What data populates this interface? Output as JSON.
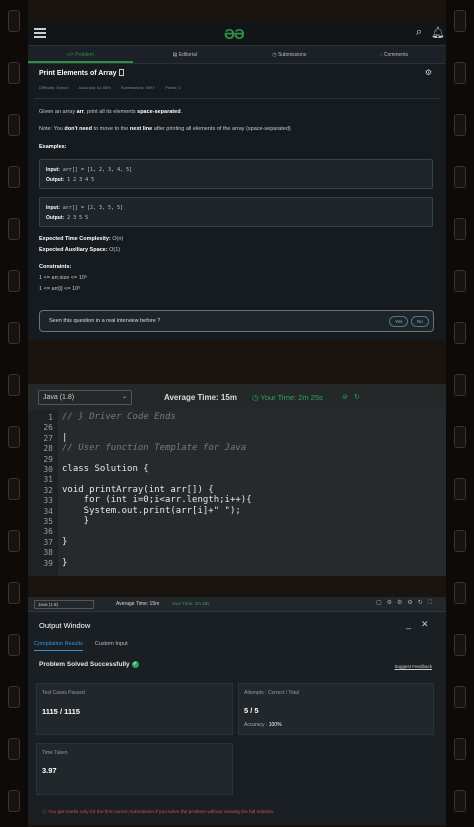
{
  "problem_panel": {
    "logo": "ƏƏ",
    "tabs": [
      "</> Problem",
      "▤ Editorial",
      "◷ Submissions",
      "◌ Comments"
    ],
    "title": "Print Elements of Array",
    "meta": [
      "Difficulty: School",
      "Accuracy: 61.55%",
      "Submissions: 90K+",
      "Points: 0"
    ],
    "description": [
      "Given an array ",
      "arr",
      ", print all its elements ",
      "space-separated",
      "."
    ],
    "note": [
      "Note: You ",
      "don't need",
      " to move to the ",
      "next line",
      " after printing all elements of the array (space-separated)"
    ],
    "examples_label": "Examples:",
    "example1": {
      "input_label": "Input:",
      "input": "arr[] = [1, 2, 3, 4, 5]",
      "output_label": "Output:",
      "output": "1 2 3 4 5"
    },
    "example2": {
      "input_label": "Input:",
      "input": "arr[] = [2, 3, 5, 5]",
      "output_label": "Output:",
      "output": "2 3 5 5"
    },
    "time_complexity_label": "Expected Time Complexity:",
    "time_complexity": "O(n)",
    "space_label": "Expected Auxiliary Space:",
    "space": "O(1)",
    "constraints_label": "Constraints:",
    "constraint1": "1 <= arr.size <= 10⁶",
    "constraint2": "1 <= arr[i] <= 10⁶",
    "interview_question": "Seen this question in a real interview before ?",
    "yes": "Yes",
    "no": "No"
  },
  "editor_panel": {
    "language": "Java (1.8)",
    "average_time": "Average Time: 15m",
    "your_time": "Your Time: 2m 25s",
    "lines": [
      {
        "n": "1",
        "text": "// } Driver Code Ends",
        "kind": "cmt"
      },
      {
        "n": "26",
        "text": "",
        "kind": ""
      },
      {
        "n": "27",
        "text": "|",
        "kind": ""
      },
      {
        "n": "28",
        "text": "// User function Template for Java",
        "kind": "cmt"
      },
      {
        "n": "29",
        "text": "",
        "kind": ""
      },
      {
        "n": "30",
        "text": "class Solution {",
        "kind": ""
      },
      {
        "n": "31",
        "text": "",
        "kind": ""
      },
      {
        "n": "32",
        "text": "void printArray(int arr[]) {",
        "kind": ""
      },
      {
        "n": "33",
        "text": "    for (int i=0;i<arr.length;i++){",
        "kind": ""
      },
      {
        "n": "34",
        "text": "    System.out.print(arr[i]+\" \");",
        "kind": ""
      },
      {
        "n": "35",
        "text": "    }",
        "kind": ""
      },
      {
        "n": "36",
        "text": "",
        "kind": ""
      },
      {
        "n": "37",
        "text": "}",
        "kind": ""
      },
      {
        "n": "38",
        "text": "",
        "kind": ""
      },
      {
        "n": "39",
        "text": "}",
        "kind": ""
      }
    ]
  },
  "output_panel": {
    "language": "Java (1.8)",
    "average_time": "Average Time: 15m",
    "your_time": "Your Time: 2m 25s",
    "title": "Output Window",
    "tabs": [
      "Compilation Results",
      "Custom Input"
    ],
    "status": "Problem Solved Successfully",
    "suggest_feedback": "Suggest Feedback",
    "test_cases_label": "Test Cases Passed",
    "test_cases": "1115 / 1115",
    "attempts_label": "Attempts : Correct / Total",
    "attempts": "5 / 5",
    "accuracy_label": "Accuracy :",
    "accuracy": "100%",
    "time_taken_label": "Time Taken",
    "time_taken": "3.97",
    "note": "You get marks only for the first correct submission if you solve the problem without viewing the full solution."
  },
  "colors": {
    "accent_green": "#2f8d46",
    "link_blue": "#3a93d9",
    "warning_red": "#d94b4b"
  }
}
